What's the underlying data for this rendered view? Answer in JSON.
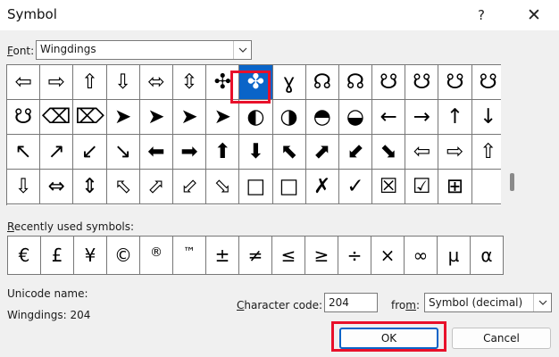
{
  "window": {
    "title": "Symbol",
    "help_glyph": "?",
    "close_glyph": "✕"
  },
  "font_picker": {
    "label_underlined": "F",
    "label_rest": "ont:",
    "value": "Wingdings"
  },
  "symbols": [
    [
      "⇦",
      "⇨",
      "⇧",
      "⇩",
      "⬄",
      "⇳",
      "✣",
      "✤",
      "ɣ",
      "☊",
      "☊",
      "☋",
      "☋",
      "☋",
      "☋"
    ],
    [
      "☋",
      "⌫",
      "⌦",
      "➤",
      "➤",
      "➤",
      "➤",
      "◐",
      "◑",
      "◓",
      "◒",
      "←",
      "→",
      "↑",
      "↓"
    ],
    [
      "↖",
      "↗",
      "↙",
      "↘",
      "⬅",
      "➡",
      "⬆",
      "⬇",
      "⬉",
      "⬈",
      "⬋",
      "⬊",
      "⇦",
      "⇨",
      "⇧"
    ],
    [
      "⇩",
      "⇔",
      "⇕",
      "⬁",
      "⬀",
      "⬃",
      "⬂",
      "□",
      "□",
      "✗",
      "✓",
      "☒",
      "☑",
      "⊞",
      ""
    ]
  ],
  "selected": {
    "row": 0,
    "col": 7
  },
  "recent": {
    "label_underlined": "R",
    "label_rest": "ecently used symbols:",
    "items": [
      "€",
      "£",
      "¥",
      "©",
      "®",
      "™",
      "±",
      "≠",
      "≤",
      "≥",
      "÷",
      "×",
      "∞",
      "µ",
      "α"
    ]
  },
  "unicode": {
    "label": "Unicode name:",
    "value": "Wingdings: 204"
  },
  "char_code": {
    "label_underlined": "C",
    "label_rest": "haracter code:",
    "value": "204"
  },
  "from": {
    "label_pre": "fro",
    "label_underlined": "m",
    "label_post": ":",
    "value": "Symbol (decimal)"
  },
  "buttons": {
    "ok": "OK",
    "cancel": "Cancel"
  },
  "colors": {
    "selection": "#0a64c8",
    "highlight": "#e8102a"
  }
}
